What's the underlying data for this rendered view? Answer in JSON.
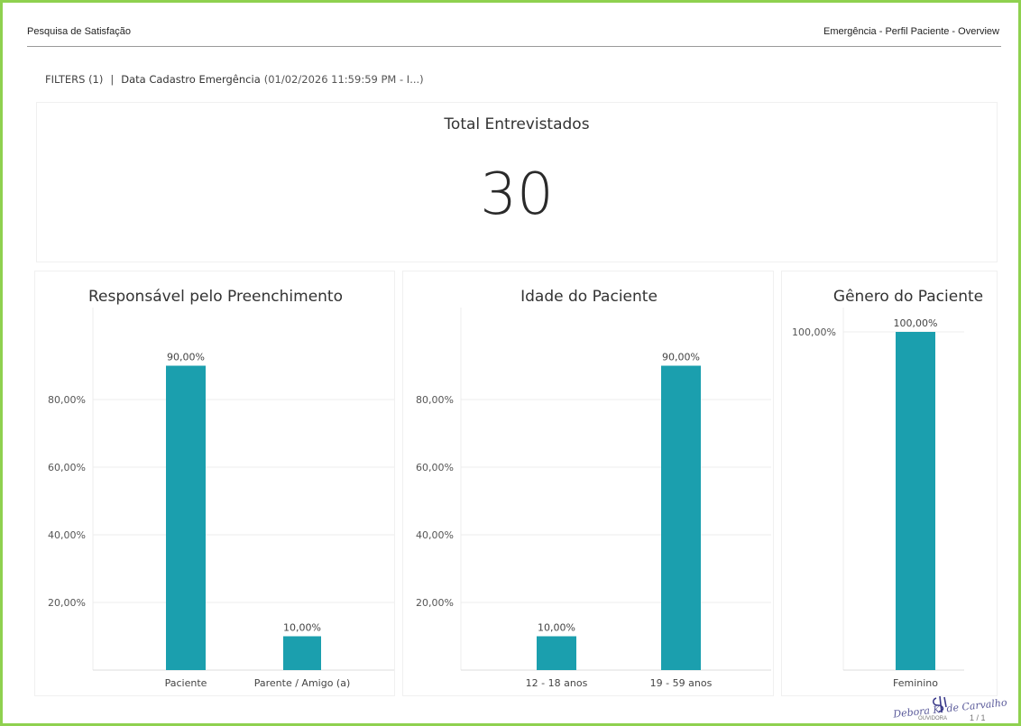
{
  "header": {
    "left": "Pesquisa de Satisfação",
    "right": "Emergência - Perfil Paciente - Overview"
  },
  "filters": {
    "label": "FILTERS (1)",
    "separator": "|",
    "name": "Data Cadastro Emergência",
    "value": "(01/02/2026 11:59:59 PM - I...)"
  },
  "kpi": {
    "title": "Total Entrevistados",
    "value": "30"
  },
  "footer": {
    "signature": "Debora K. de Carvalho",
    "signature_role": "OUVIDORA",
    "page": "1 / 1"
  },
  "colors": {
    "bar": "#1b9fae",
    "frame": "#8fd14f",
    "grid": "#ececec"
  },
  "chart_data": [
    {
      "type": "bar",
      "title": "Responsável pelo Preenchimento",
      "categories": [
        "Paciente",
        "Parente / Amigo (a)"
      ],
      "values": [
        90,
        10
      ],
      "data_labels": [
        "90,00%",
        "10,00%"
      ],
      "yticks": [
        "20,00%",
        "40,00%",
        "60,00%",
        "80,00%"
      ],
      "ytick_values": [
        20,
        40,
        60,
        80
      ],
      "ylim": [
        0,
        100
      ],
      "grid": true
    },
    {
      "type": "bar",
      "title": "Idade do Paciente",
      "categories": [
        "12 - 18 anos",
        "19 - 59 anos"
      ],
      "values": [
        10,
        90
      ],
      "data_labels": [
        "10,00%",
        "90,00%"
      ],
      "yticks": [
        "20,00%",
        "40,00%",
        "60,00%",
        "80,00%"
      ],
      "ytick_values": [
        20,
        40,
        60,
        80
      ],
      "ylim": [
        0,
        100
      ],
      "grid": true
    },
    {
      "type": "bar",
      "title": "Gênero do Paciente",
      "categories": [
        "Feminino"
      ],
      "values": [
        100
      ],
      "data_labels": [
        "100,00%"
      ],
      "yticks": [
        "100,00%"
      ],
      "ytick_values": [
        100
      ],
      "ylim": [
        0,
        100
      ],
      "grid": true
    }
  ]
}
